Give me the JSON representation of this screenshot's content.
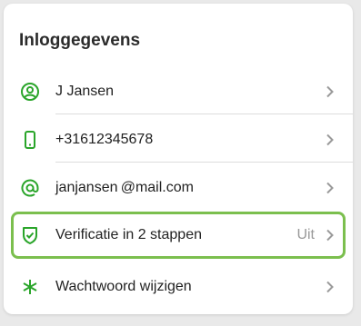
{
  "section": {
    "title": "Inloggegevens"
  },
  "rows": [
    {
      "icon": "user-circle-icon",
      "label": "J Jansen",
      "value": ""
    },
    {
      "icon": "phone-icon",
      "label": "+31612345678",
      "value": ""
    },
    {
      "icon": "at-sign-icon",
      "label": "janjansen @mail.com",
      "value": ""
    },
    {
      "icon": "shield-check-icon",
      "label": "Verificatie in 2 stappen",
      "value": "Uit",
      "highlighted": true
    },
    {
      "icon": "asterisk-icon",
      "label": "Wachtwoord wijzigen",
      "value": ""
    }
  ],
  "colors": {
    "icon_green": "#2aa52a",
    "highlight_border": "#7bbf4e",
    "chevron": "#9a9a9a"
  }
}
